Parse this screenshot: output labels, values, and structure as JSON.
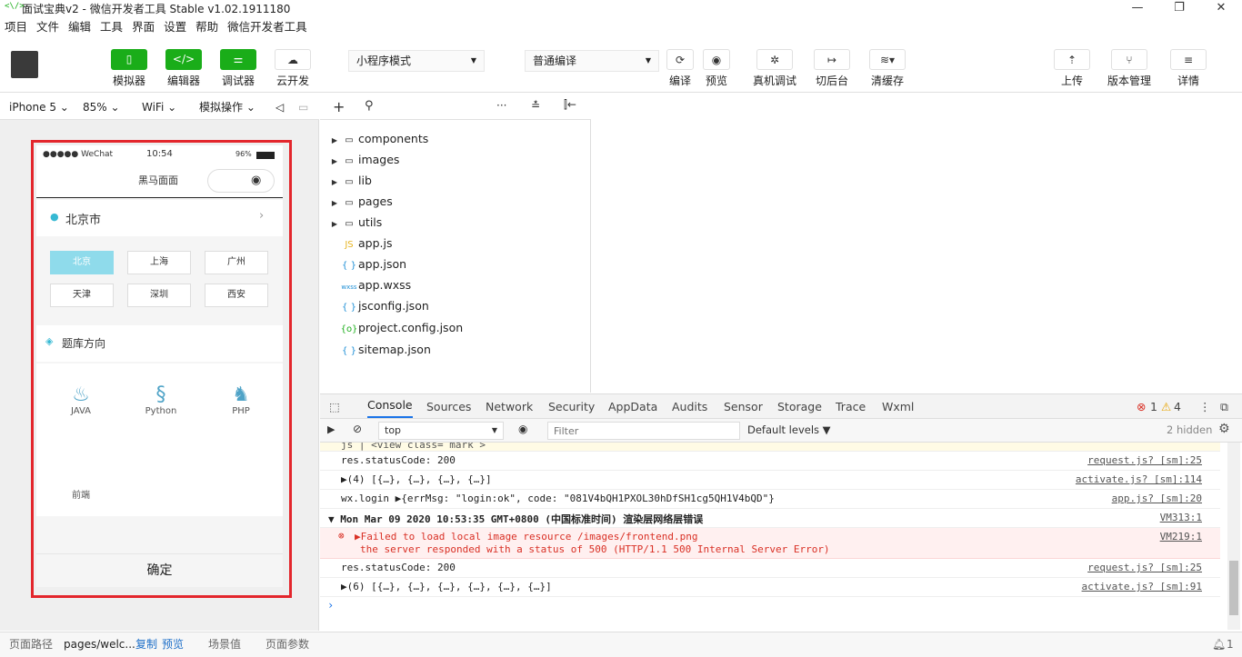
{
  "window": {
    "title": "面试宝典v2 - 微信开发者工具 Stable v1.02.1911180",
    "logo_text": "<\\/>"
  },
  "menu": [
    "项目",
    "文件",
    "编辑",
    "工具",
    "界面",
    "设置",
    "帮助",
    "微信开发者工具"
  ],
  "toolbar": {
    "simulator": "模拟器",
    "editor": "编辑器",
    "debugger": "调试器",
    "cloud": "云开发",
    "mode": "小程序模式",
    "compile_mode": "普通编译",
    "compile": "编译",
    "preview": "预览",
    "remote_debug": "真机调试",
    "backstage": "切后台",
    "clear_cache": "清缓存",
    "upload": "上传",
    "version": "版本管理",
    "details": "详情"
  },
  "sim_bar": {
    "device": "iPhone 5",
    "zoom": "85%",
    "network": "WiFi",
    "sim_ops": "模拟操作"
  },
  "phone": {
    "status_carrier": "●●●●● WeChat",
    "time": "10:54",
    "battery": "96%",
    "nav_title": "黑马面面",
    "location": "北京市",
    "cities": [
      "北京",
      "上海",
      "广州",
      "天津",
      "深圳",
      "西安"
    ],
    "section_title": "题库方向",
    "langs": [
      "JAVA",
      "Python",
      "PHP",
      "前端"
    ],
    "confirm": "确定"
  },
  "files": [
    {
      "name": "components",
      "type": "folder"
    },
    {
      "name": "images",
      "type": "folder"
    },
    {
      "name": "lib",
      "type": "folder"
    },
    {
      "name": "pages",
      "type": "folder"
    },
    {
      "name": "utils",
      "type": "folder"
    },
    {
      "name": "app.js",
      "type": "js",
      "icon": "JS"
    },
    {
      "name": "app.json",
      "type": "json",
      "icon": "{ }"
    },
    {
      "name": "app.wxss",
      "type": "wxss",
      "icon": "wxss"
    },
    {
      "name": "jsconfig.json",
      "type": "json",
      "icon": "{ }"
    },
    {
      "name": "project.config.json",
      "type": "json",
      "icon": "{o}"
    },
    {
      "name": "sitemap.json",
      "type": "json",
      "icon": "{ }"
    }
  ],
  "devtools": {
    "tabs": [
      "Console",
      "Sources",
      "Network",
      "Security",
      "AppData",
      "Audits",
      "Sensor",
      "Storage",
      "Trace",
      "Wxml"
    ],
    "errors": "1",
    "warnings": "4",
    "context": "top",
    "filter_placeholder": "Filter",
    "levels": "Default levels ▼",
    "hidden": "2 hidden"
  },
  "console": [
    {
      "msg": "js   |             <view class= mark >",
      "src": ""
    },
    {
      "msg": "res.statusCode:  200",
      "src": "request.js? [sm]:25"
    },
    {
      "msg": "▶(4) [{…}, {…}, {…}, {…}]",
      "src": "activate.js? [sm]:114"
    },
    {
      "msg": "wx.login ▶{errMsg: \"login:ok\", code: \"081V4bQH1PXOL30hDfSH1cg5QH1V4bQD\"}",
      "src": "app.js? [sm]:20"
    },
    {
      "msg": "▼ Mon Mar 09 2020 10:53:35 GMT+0800 (中国标准时间) 渲染层网络层错误",
      "src": "VM313:1"
    },
    {
      "msg": "▶Failed to load local image resource /images/frontend.png",
      "msg2": "the server responded with a status of 500 (HTTP/1.1 500 Internal Server Error)",
      "src": "VM219:1"
    },
    {
      "msg": "res.statusCode:  200",
      "src": "request.js? [sm]:25"
    },
    {
      "msg": "▶(6) [{…}, {…}, {…}, {…}, {…}, {…}]",
      "src": "activate.js? [sm]:91"
    }
  ],
  "status": {
    "path_label": "页面路径",
    "path": "pages/welc...",
    "copy": "复制",
    "preview": "预览",
    "scene": "场景值",
    "params": "页面参数",
    "notif": "1"
  }
}
